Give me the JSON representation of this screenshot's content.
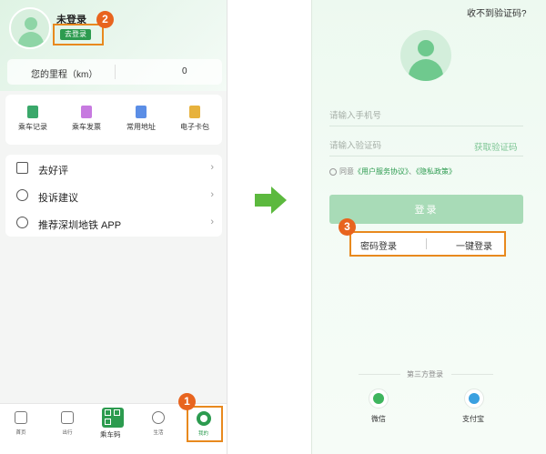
{
  "left": {
    "profile": {
      "status": "未登录",
      "login_button": "去登录"
    },
    "mileage": {
      "label": "您的里程（km）",
      "value": "0"
    },
    "services": [
      {
        "label": "乘车记录",
        "icon": "ride-record-icon",
        "color": "#3aa86a"
      },
      {
        "label": "乘车发票",
        "icon": "invoice-icon",
        "color": "#c77ae0"
      },
      {
        "label": "常用地址",
        "icon": "address-icon",
        "color": "#5b8ee6"
      },
      {
        "label": "电子卡包",
        "icon": "card-wallet-icon",
        "color": "#e7b23d"
      }
    ],
    "menu": [
      {
        "label": "去好评",
        "icon": "thumbs-up-icon"
      },
      {
        "label": "投诉建议",
        "icon": "question-icon"
      },
      {
        "label": "推荐深圳地铁 APP",
        "icon": "heart-icon"
      }
    ],
    "tabs": {
      "home": "首页",
      "travel": "出行",
      "qr": "乘车码",
      "life": "生活",
      "me": "我的"
    }
  },
  "annotations": {
    "badge1": "1",
    "badge2": "2",
    "badge3": "3"
  },
  "right": {
    "no_code": "收不到验证码?",
    "phone_placeholder": "请输入手机号",
    "code_placeholder": "请输入验证码",
    "get_code": "获取验证码",
    "agreement": {
      "prefix": "同意",
      "service": "《用户服务协议》",
      "and": "、",
      "privacy": "《隐私政策》"
    },
    "login_button": "登录",
    "password_login": "密码登录",
    "one_click_login": "一键登录",
    "third_party": "第三方登录",
    "wechat": "微信",
    "alipay": "支付宝"
  },
  "colors": {
    "brand_green": "#2c9b4f",
    "highlight_orange": "#e8891e",
    "badge_orange": "#e8641e",
    "arrow_green": "#5cb93e"
  }
}
